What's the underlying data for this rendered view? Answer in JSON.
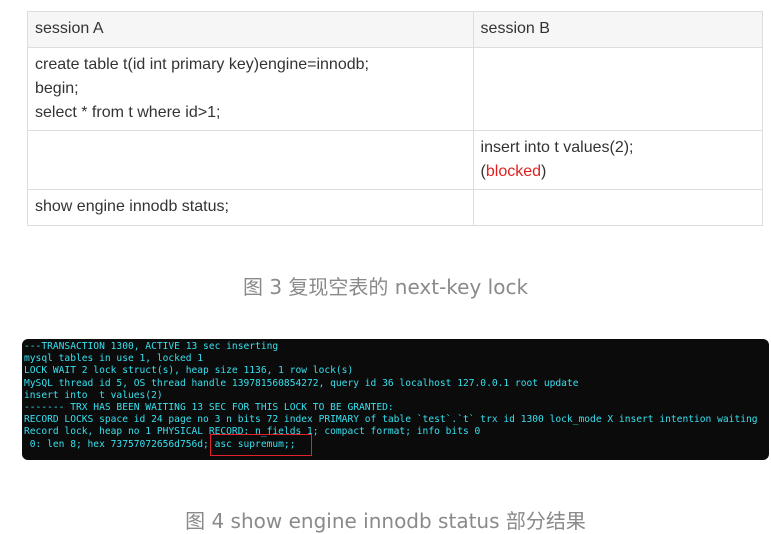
{
  "table": {
    "headers": [
      "session A",
      "session B"
    ],
    "rows": [
      {
        "a": [
          "create table t(id int primary key)engine=innodb;",
          "begin;",
          "select * from t where id>1;"
        ],
        "b": []
      },
      {
        "a": [],
        "b": [
          "insert into  t values(2);"
        ],
        "b_blocked": {
          "open": "(",
          "word": "blocked",
          "close": ")"
        }
      },
      {
        "a": [
          "show engine innodb status;"
        ],
        "b": []
      }
    ]
  },
  "caption3": "图 3 复现空表的 next-key lock",
  "terminal": {
    "lines": [
      "---TRANSACTION 1300, ACTIVE 13 sec inserting",
      "mysql tables in use 1, locked 1",
      "LOCK WAIT 2 lock struct(s), heap size 1136, 1 row lock(s)",
      "MySQL thread id 5, OS thread handle 139781560854272, query id 36 localhost 127.0.0.1 root update",
      "insert into  t values(2)",
      "------- TRX HAS BEEN WAITING 13 SEC FOR THIS LOCK TO BE GRANTED:",
      "RECORD LOCKS space id 24 page no 3 n bits 72 index PRIMARY of table `test`.`t` trx id 1300 lock_mode X insert intention waiting",
      "Record lock, heap no 1 PHYSICAL RECORD: n_fields 1; compact format; info bits 0",
      " 0: len 8; hex 73757072656d756d; asc supremum;;"
    ],
    "text_color": "#36e0ee",
    "highlight_color": "#e2212a"
  },
  "caption4": "图 4 show engine innodb status 部分结果"
}
